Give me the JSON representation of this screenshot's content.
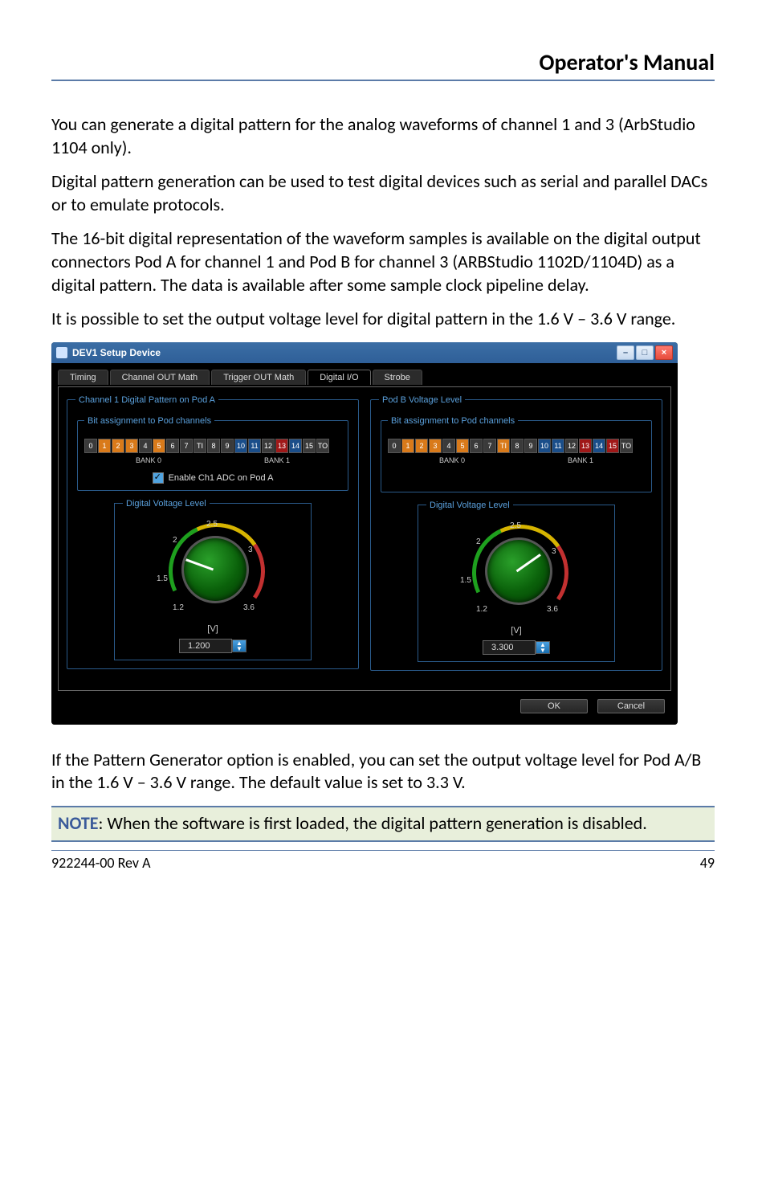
{
  "header": {
    "title": "Operator's Manual"
  },
  "para1": "You can generate a digital pattern for the analog waveforms of channel 1 and 3 (ArbStudio 1104 only).",
  "para2": "Digital pattern generation can be used to test digital devices such as serial and parallel DACs or to emulate protocols.",
  "para3": "The 16-bit digital representation of the waveform samples is available on the digital output connectors Pod A for channel 1 and Pod B for channel 3 (ARBStudio 1102D/1104D) as a digital pattern. The data is available after some sample clock pipeline delay.",
  "para4": "It is possible to set the output voltage level for digital pattern in the 1.6 V – 3.6 V range.",
  "dialog": {
    "title": "DEV1 Setup Device",
    "tabs": {
      "timing": "Timing",
      "chout": "Channel OUT Math",
      "trigout": "Trigger OUT Math",
      "digio": "Digital I/O",
      "strobe": "Strobe"
    },
    "left": {
      "group": "Channel 1 Digital Pattern on Pod A",
      "bits": "Bit assignment to Pod channels",
      "bank0": "BANK 0",
      "bank1": "BANK 1",
      "enable": "Enable Ch1 ADC on Pod A",
      "dvl": "Digital Voltage Level",
      "unit": "[V]",
      "value": "1.200",
      "ticks": {
        "t12": "1.2",
        "t15": "1.5",
        "t2": "2",
        "t25": "2.5",
        "t3": "3",
        "t36": "3.6"
      }
    },
    "right": {
      "group": "Pod B Voltage Level",
      "bits": "Bit assignment to Pod channels",
      "bank0": "BANK 0",
      "bank1": "BANK 1",
      "dvl": "Digital Voltage Level",
      "unit": "[V]",
      "value": "3.300",
      "ticks": {
        "t12": "1.2",
        "t15": "1.5",
        "t2": "2",
        "t25": "2.5",
        "t3": "3",
        "t36": "3.6"
      }
    },
    "bits": [
      "0",
      "1",
      "2",
      "3",
      "4",
      "5",
      "6",
      "7",
      "TI",
      "8",
      "9",
      "10",
      "11",
      "12",
      "13",
      "14",
      "15",
      "TO"
    ],
    "buttons": {
      "ok": "OK",
      "cancel": "Cancel"
    }
  },
  "para5": "If the Pattern Generator option is enabled, you can set the output voltage level for Pod A/B in the 1.6 V – 3.6 V range. The default value is set to 3.3 V.",
  "note": {
    "label": "NOTE",
    "text": ": When the software is first loaded, the digital pattern generation is disabled."
  },
  "footer": {
    "left": "922244-00 Rev A",
    "right": "49"
  }
}
